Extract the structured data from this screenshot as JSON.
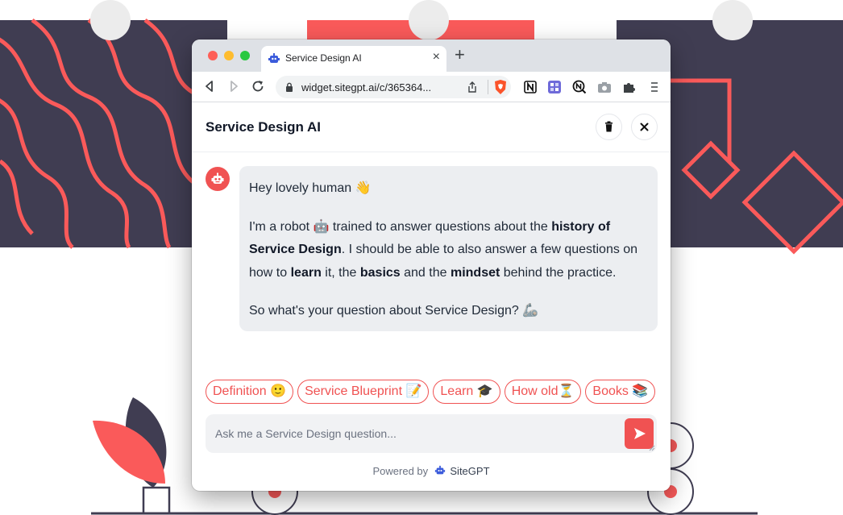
{
  "browser": {
    "tab_title": "Service Design AI",
    "tab_close": "×",
    "new_tab": "+",
    "url": "widget.sitegpt.ai/c/365364...",
    "extensions": [
      "notion-icon",
      "grid-icon",
      "n-circle-icon",
      "camera-icon",
      "puzzle-icon",
      "menu-icon"
    ]
  },
  "widget": {
    "title": "Service Design AI",
    "message": {
      "greeting": "Hey lovely human 👋",
      "p2": [
        {
          "t": "I'm a robot 🤖 trained to answer questions about the "
        },
        {
          "t": "history of Service Design",
          "b": true
        },
        {
          "t": ". I should be able to also answer a few questions on how to "
        },
        {
          "t": "learn",
          "b": true
        },
        {
          "t": " it, the "
        },
        {
          "t": "basics",
          "b": true
        },
        {
          "t": " and the "
        },
        {
          "t": "mindset",
          "b": true
        },
        {
          "t": " behind the practice."
        }
      ],
      "p3": "So what's your question about Service Design? 🦾"
    },
    "suggestions": [
      "Definition 🙂",
      "Service Blueprint 📝",
      "Learn 🎓",
      "How old⏳",
      "Books 📚"
    ],
    "input_placeholder": "Ask me a Service Design question...",
    "powered_prefix": "Powered by",
    "powered_brand": "SiteGPT"
  },
  "colors": {
    "accent": "#f05252",
    "backdrop_dark": "#403d52",
    "backdrop_shape": "#fa5a5a"
  }
}
